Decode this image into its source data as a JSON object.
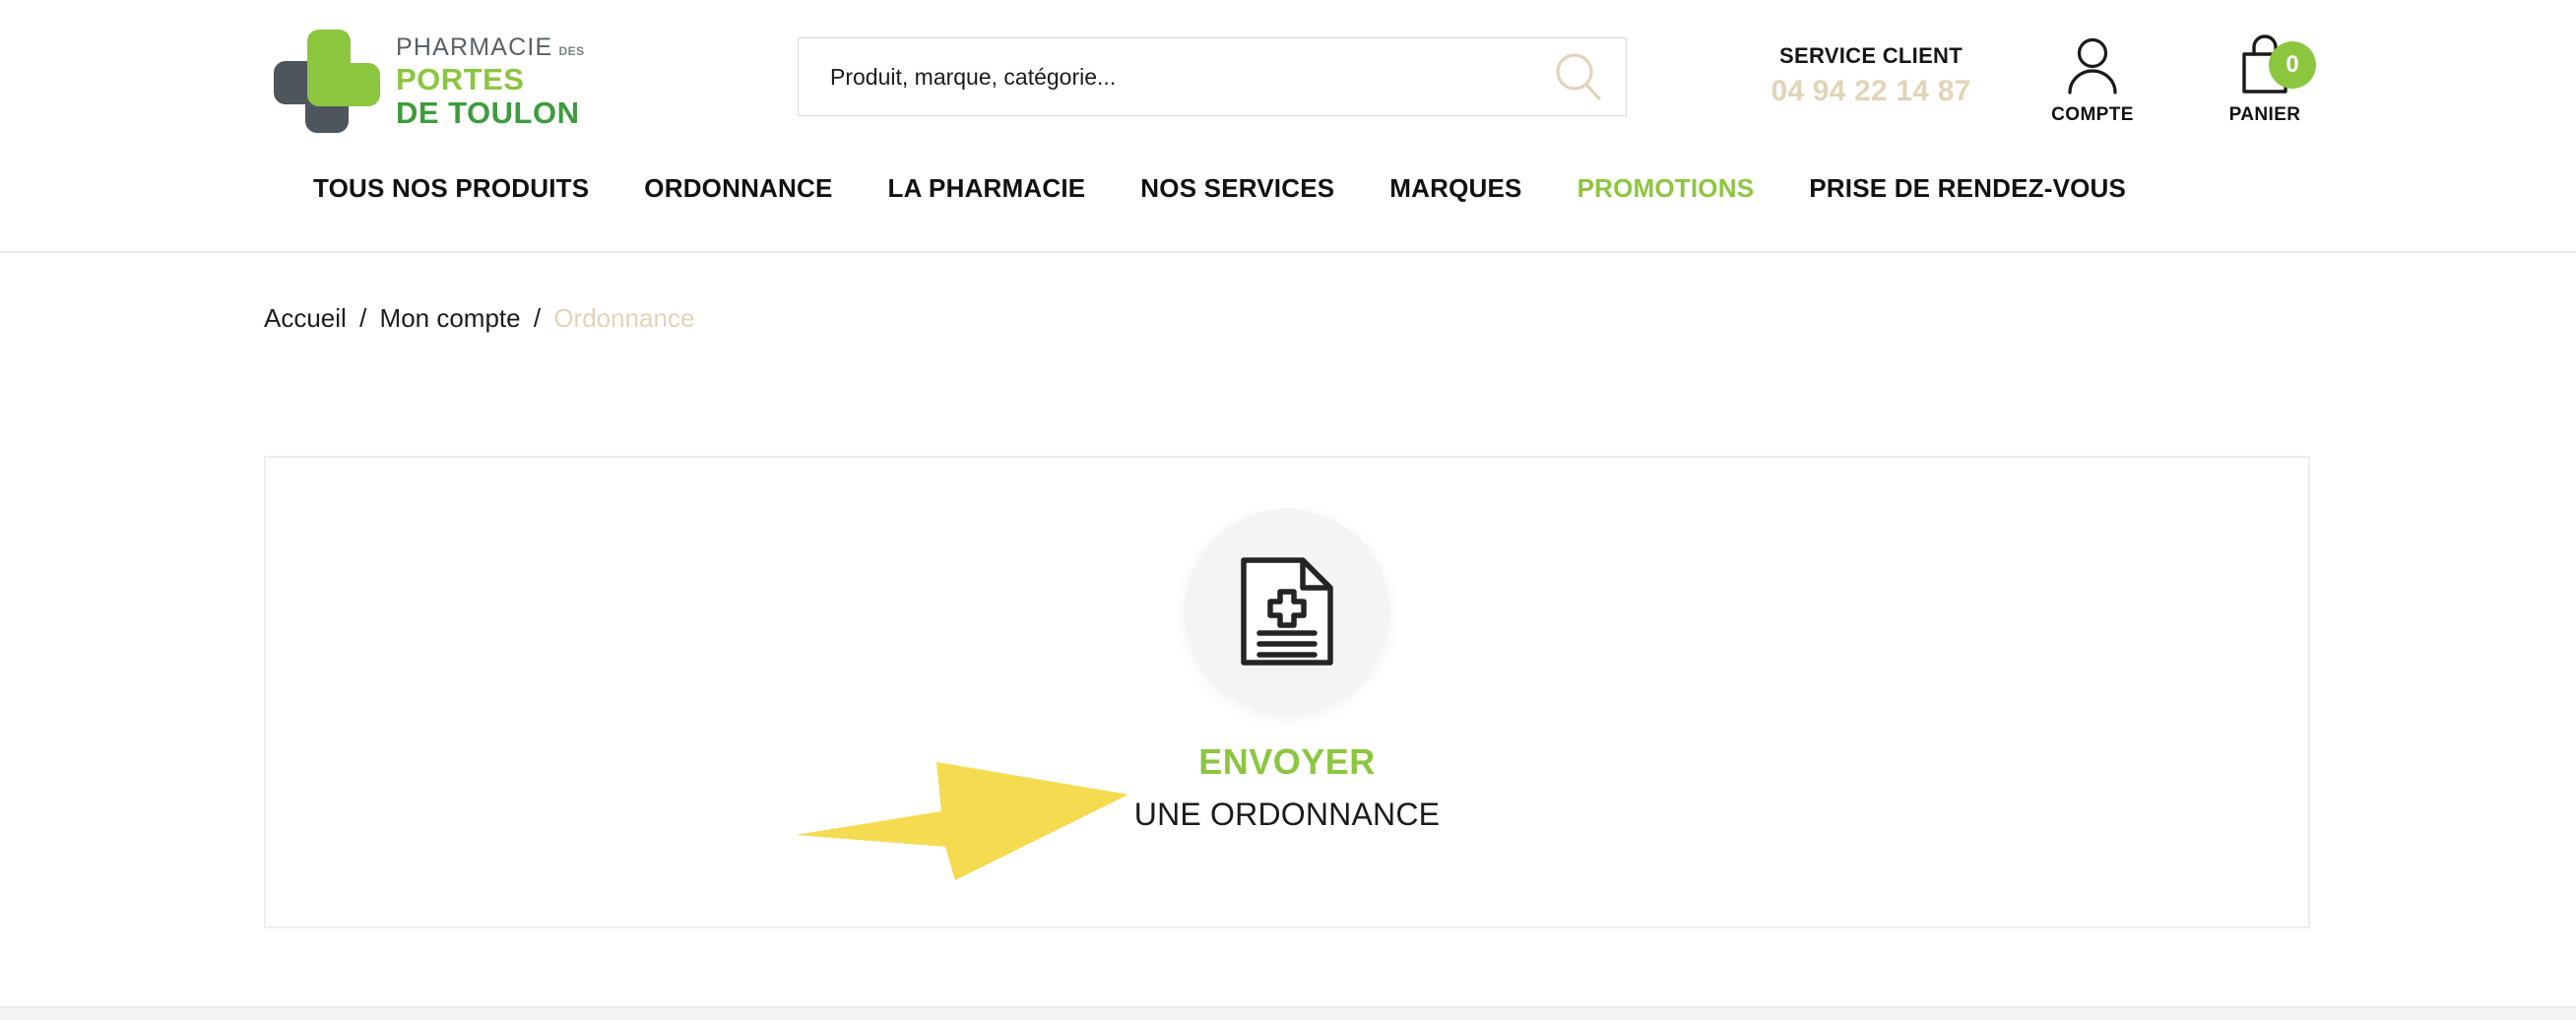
{
  "header": {
    "logo": {
      "line1": "PHARMACIE",
      "line1_suffix": "DES",
      "line2": "PORTES",
      "line3": "DE TOULON",
      "mark_icon": "pharmacy-cross-logo-icon",
      "green": "#8CC63F",
      "dark_green": "#3C9C3C",
      "gray": "#4D565C"
    },
    "search": {
      "placeholder": "Produit, marque, catégorie...",
      "value": "",
      "icon": "search-icon",
      "icon_color": "#E1D4B8"
    },
    "service": {
      "label": "SERVICE CLIENT",
      "phone": "04 94 22 14 87",
      "phone_color": "#E1D4B8"
    },
    "account": {
      "label": "COMPTE",
      "icon": "user-icon"
    },
    "cart": {
      "label": "PANIER",
      "icon": "shopping-bag-icon",
      "count": "0",
      "badge_color": "#8CC63F"
    }
  },
  "nav": {
    "items": [
      {
        "label": "TOUS NOS PRODUITS",
        "accent": false
      },
      {
        "label": "ORDONNANCE",
        "accent": false
      },
      {
        "label": "LA PHARMACIE",
        "accent": false
      },
      {
        "label": "NOS SERVICES",
        "accent": false
      },
      {
        "label": "MARQUES",
        "accent": false
      },
      {
        "label": "PROMOTIONS",
        "accent": true
      },
      {
        "label": "PRISE DE RENDEZ-VOUS",
        "accent": false
      }
    ],
    "accent_color": "#8CC63F"
  },
  "breadcrumb": {
    "home": "Accueil",
    "account": "Mon compte",
    "current": "Ordonnance",
    "separator": "/",
    "current_color": "#E1D4B8"
  },
  "main": {
    "send_prescription": {
      "icon": "prescription-document-icon",
      "title": "ENVOYER",
      "subtitle": "UNE ORDONNANCE",
      "title_color": "#8CC63F"
    },
    "annotation": {
      "icon": "yellow-arrow-annotation-icon",
      "color": "#F5DB4F",
      "direction": "right"
    }
  }
}
